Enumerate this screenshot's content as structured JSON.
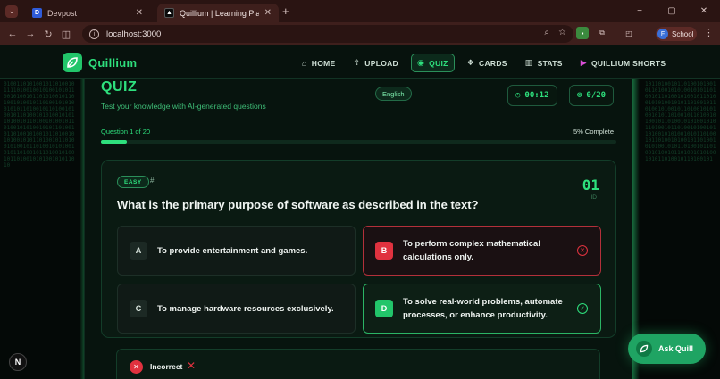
{
  "browser": {
    "tabs": [
      {
        "title": "Devpost",
        "favicon": "D"
      },
      {
        "title": "Quillium | Learning Platform",
        "favicon": "▲"
      }
    ],
    "new_tab": "+",
    "address": "localhost:3000",
    "profile_initial": "F",
    "profile_label": "School",
    "window_controls": [
      "−",
      "▢",
      "✕"
    ]
  },
  "app": {
    "brand": "Quillium",
    "nav": [
      {
        "label": "HOME",
        "icon": "home-icon",
        "glyph": "⌂"
      },
      {
        "label": "UPLOAD",
        "icon": "upload-icon",
        "glyph": "⇪"
      },
      {
        "label": "QUIZ",
        "icon": "quiz-icon",
        "glyph": "◉",
        "active": true
      },
      {
        "label": "CARDS",
        "icon": "cards-icon",
        "glyph": "❖"
      },
      {
        "label": "STATS",
        "icon": "stats-icon",
        "glyph": "▥"
      },
      {
        "label": "QUILLIUM SHORTS",
        "icon": "shorts-icon",
        "glyph": "▶"
      }
    ],
    "quiz": {
      "title": "QUIZ",
      "subtitle": "Test your knowledge with AI-generated questions",
      "language": "English",
      "timer": "00:12",
      "score": "0/20",
      "question_counter": "Question 1 of 20",
      "percent_complete": "5% Complete",
      "progress": 0.05,
      "difficulty": "EASY",
      "hash": "#",
      "number": "01",
      "id_label": "ID",
      "question": "What is the primary purpose of software as described in the text?",
      "options": [
        {
          "letter": "A",
          "text": "To provide entertainment and games.",
          "state": "neutral"
        },
        {
          "letter": "B",
          "text": "To perform complex mathematical calculations only.",
          "state": "wrong"
        },
        {
          "letter": "C",
          "text": "To manage hardware resources exclusively.",
          "state": "neutral"
        },
        {
          "letter": "D",
          "text": "To solve real-world problems, automate processes, or enhance productivity.",
          "state": "correct"
        }
      ],
      "feedback": "Incorrect"
    },
    "ask_button": "Ask Quill",
    "dev_badge": "N"
  },
  "colors": {
    "accent": "#2ee07d",
    "wrong": "#e0323f",
    "browser": "#3e1f1c"
  }
}
